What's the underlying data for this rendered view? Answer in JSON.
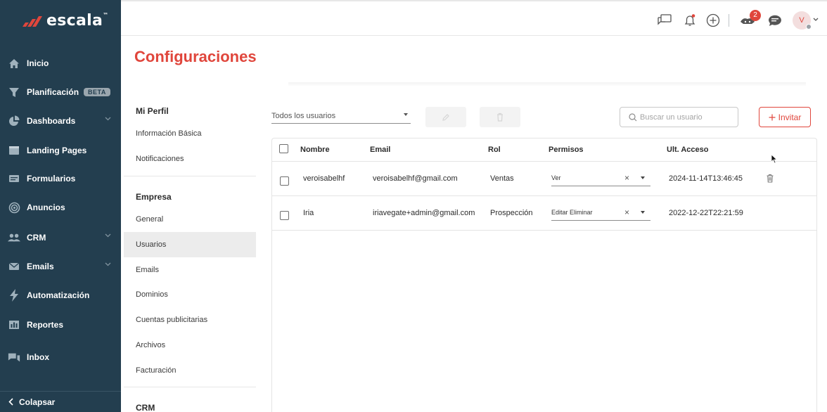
{
  "brand": {
    "name": "escala",
    "tm": "™",
    "accent": "#e0463c",
    "sidebar_bg": "#233e4f"
  },
  "sidebar": {
    "items": [
      {
        "label": "Inicio",
        "icon": "home-icon"
      },
      {
        "label": "Planificación",
        "icon": "funnel-icon",
        "badge": "BETA"
      },
      {
        "label": "Dashboards",
        "icon": "pie-chart-icon",
        "expandable": true
      },
      {
        "label": "Landing Pages",
        "icon": "browser-window-icon"
      },
      {
        "label": "Formularios",
        "icon": "form-icon"
      },
      {
        "label": "Anuncios",
        "icon": "target-icon"
      },
      {
        "label": "CRM",
        "icon": "users-icon",
        "expandable": true
      },
      {
        "label": "Emails",
        "icon": "envelope-icon",
        "expandable": true
      },
      {
        "label": "Automatización",
        "icon": "lightning-icon"
      },
      {
        "label": "Reportes",
        "icon": "bar-chart-icon"
      },
      {
        "label": "Inbox",
        "icon": "chat-bubbles-icon"
      }
    ],
    "collapse_label": "Colapsar"
  },
  "topbar": {
    "icons": [
      "feedback-icon",
      "notification-bell-icon",
      "add-circle-icon",
      "referral-icon",
      "support-chat-icon"
    ],
    "notification_count": "2",
    "avatar_initial": "V"
  },
  "page": {
    "title": "Configuraciones"
  },
  "subnav": {
    "sections": [
      {
        "title": "Mi Perfil",
        "items": [
          "Información Básica",
          "Notificaciones"
        ]
      },
      {
        "title": "Empresa",
        "items": [
          "General",
          "Usuarios",
          "Emails",
          "Dominios",
          "Cuentas publicitarias",
          "Archivos",
          "Facturación"
        ]
      },
      {
        "title": "CRM",
        "items": []
      }
    ],
    "active_item": "Usuarios"
  },
  "users": {
    "filter_value": "Todos los usuarios",
    "search_placeholder": "Buscar un usuario",
    "invite_label": "Invitar",
    "columns": [
      "Nombre",
      "Email",
      "Rol",
      "Permisos",
      "Ult. Acceso"
    ],
    "rows": [
      {
        "name": "veroisabelhf",
        "email": "veroisabelhf@gmail.com",
        "role": "Ventas",
        "permissions": "Ver",
        "last_access": "2024-11-14T13:46:45"
      },
      {
        "name": "Iria",
        "email": "iriavegate+admin@gmail.com",
        "role": "Prospección",
        "permissions": "Editar Eliminar",
        "last_access": "2022-12-22T22:21:59"
      }
    ]
  }
}
